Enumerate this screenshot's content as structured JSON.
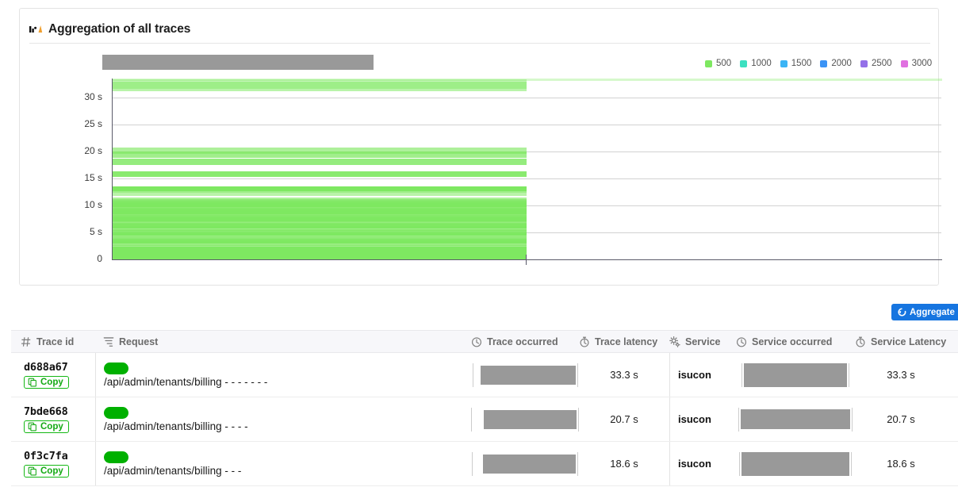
{
  "panel": {
    "title": "Aggregation of all traces",
    "title_icon": "line-chart-icon"
  },
  "chart_data": {
    "type": "bar",
    "orientation": "horizontal-stacked-timeline",
    "title": "Aggregation of all traces",
    "xlabel": "",
    "ylabel": "",
    "ytick_labels": [
      "0",
      "5 s",
      "10 s",
      "15 s",
      "20 s",
      "25 s",
      "30 s"
    ],
    "ytick_values": [
      0,
      5,
      10,
      15,
      20,
      25,
      30
    ],
    "ylim": [
      0,
      33.5
    ],
    "grid": true,
    "legend_position": "top-right",
    "legend": [
      {
        "label": "500",
        "color": "#7ee861"
      },
      {
        "label": "1000",
        "color": "#3ce0c0"
      },
      {
        "label": "2000",
        "color": "#3b93f5"
      },
      {
        "label": "1500",
        "color": "#3bb4f5"
      },
      {
        "label": "2500",
        "color": "#9470e8"
      },
      {
        "label": "3000",
        "color": "#e070e0"
      }
    ],
    "series": [
      {
        "name": "500",
        "color": "#7ee861",
        "note": "Dense stack of per-trace latency bars, all status 500; longest trace 33.3 s.",
        "values": [
          33.3,
          32.9,
          20.7,
          20.0,
          18.6,
          16.3,
          13.5,
          13.1,
          12.6,
          11.4,
          11.1,
          10.9,
          10.6,
          10.4,
          10.2,
          10.0,
          9.8,
          9.6,
          9.4,
          9.2,
          9.0,
          8.8,
          8.6,
          8.4,
          8.2,
          8.0,
          7.8,
          7.6,
          7.4,
          7.2,
          7.0,
          6.8,
          6.6,
          6.4,
          6.2,
          6.0,
          5.8,
          5.6,
          5.4,
          5.2,
          5.0,
          4.8,
          4.6,
          4.4,
          4.2,
          4.0,
          3.8,
          3.6,
          3.4,
          3.2,
          3.0,
          2.8,
          2.6,
          2.4,
          2.2,
          2.0,
          1.8,
          1.6,
          1.4,
          1.2,
          1.0,
          0.8,
          0.6,
          0.4,
          0.2
        ]
      }
    ]
  },
  "toolbar": {
    "aggregate_label": "Aggregate",
    "aggregate_icon": "refresh-icon",
    "accent_color": "#1675e0"
  },
  "table": {
    "columns": [
      {
        "label": "Trace id",
        "icon": "hash-icon"
      },
      {
        "label": "Request",
        "icon": "filter-icon"
      },
      {
        "label": "Trace occurred",
        "icon": "clock-icon"
      },
      {
        "label": "Trace latency",
        "icon": "stopwatch-icon"
      },
      {
        "label": "Service",
        "icon": "gears-icon"
      },
      {
        "label": "Service occurred",
        "icon": "clock-icon"
      },
      {
        "label": "Service Latency",
        "icon": "stopwatch-icon"
      }
    ],
    "copy_label": "Copy",
    "rows": [
      {
        "trace_id": "d688a67",
        "status_color": "#00b000",
        "request": "/api/admin/tenants/billing - - - - - - -",
        "trace_latency": "33.3 s",
        "service": "isucon",
        "service_latency": "33.3 s"
      },
      {
        "trace_id": "7bde668",
        "status_color": "#00b000",
        "request": "/api/admin/tenants/billing - - - -",
        "trace_latency": "20.7 s",
        "service": "isucon",
        "service_latency": "20.7 s"
      },
      {
        "trace_id": "0f3c7fa",
        "status_color": "#00b000",
        "request": "/api/admin/tenants/billing - - -",
        "trace_latency": "18.6 s",
        "service": "isucon",
        "service_latency": "18.6 s"
      }
    ]
  }
}
